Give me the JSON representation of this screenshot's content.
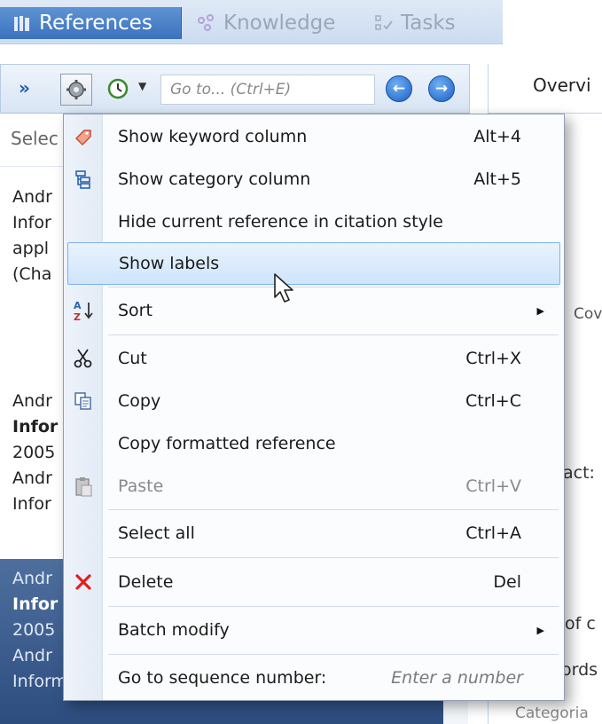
{
  "tabs": [
    {
      "label": "References",
      "icon": "books-icon",
      "active": true
    },
    {
      "label": "Knowledge",
      "icon": "knowledge-icon",
      "active": false
    },
    {
      "label": "Tasks",
      "icon": "tasks-icon",
      "active": false
    }
  ],
  "toolbar": {
    "expand": "»",
    "goto_placeholder": "Go to... (Ctrl+E)",
    "back": "←",
    "forward": "→"
  },
  "search": {
    "placeholder": "Selec"
  },
  "references": [
    {
      "lines": [
        "Andr",
        "Infor",
        "appl",
        "(Cha"
      ]
    },
    {
      "lines": [
        "Andr",
        "Infor",
        "2005",
        "Andr",
        "Infor"
      ]
    },
    {
      "lines": [
        "Andr",
        "Infor",
        "2005",
        "Andr",
        "Information"
      ]
    }
  ],
  "right": {
    "tab": "Overvi",
    "labels": [
      "Cov",
      "act:",
      "of c",
      "ords",
      "Categoria"
    ]
  },
  "menu": {
    "items": [
      {
        "label": "Show keyword column",
        "shortcut": "Alt+4",
        "icon": "keyword-icon"
      },
      {
        "label": "Show category column",
        "shortcut": "Alt+5",
        "icon": "category-icon"
      },
      {
        "label": "Hide current reference in citation style",
        "shortcut": ""
      },
      {
        "label": "Show labels",
        "shortcut": "",
        "hover": true
      },
      {
        "label": "Sort",
        "submenu": true,
        "icon": "sort-az-icon"
      },
      {
        "label": "Cut",
        "shortcut": "Ctrl+X",
        "icon": "scissors-icon"
      },
      {
        "label": "Copy",
        "shortcut": "Ctrl+C",
        "icon": "copy-icon"
      },
      {
        "label": "Copy formatted reference",
        "shortcut": ""
      },
      {
        "label": "Paste",
        "shortcut": "Ctrl+V",
        "icon": "paste-icon",
        "disabled": true
      },
      {
        "label": "Select all",
        "shortcut": "Ctrl+A"
      },
      {
        "label": "Delete",
        "shortcut": "Del",
        "icon": "delete-x-icon"
      },
      {
        "label": "Batch modify",
        "submenu": true
      },
      {
        "label": "Go to sequence number:",
        "hint": "Enter a number"
      }
    ]
  },
  "colors": {
    "accent": "#3b72bd",
    "hover": "#cfe5fb",
    "delete": "#e02020"
  }
}
